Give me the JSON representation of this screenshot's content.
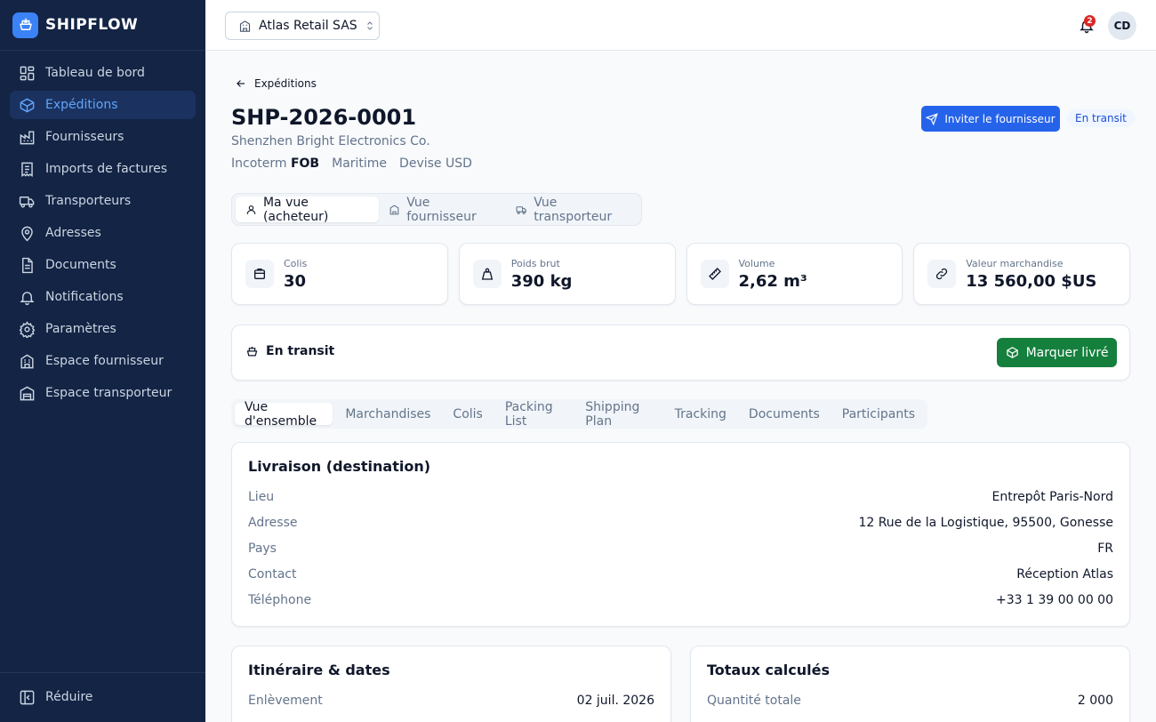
{
  "brand": {
    "name": "SHIPFLOW"
  },
  "sidebar": {
    "items": [
      {
        "label": "Tableau de bord",
        "icon": "dashboard-icon"
      },
      {
        "label": "Expéditions",
        "icon": "package-icon",
        "active": true
      },
      {
        "label": "Fournisseurs",
        "icon": "factory-icon"
      },
      {
        "label": "Imports de factures",
        "icon": "receipt-icon"
      },
      {
        "label": "Transporteurs",
        "icon": "truck-icon"
      },
      {
        "label": "Adresses",
        "icon": "map-pin-icon"
      },
      {
        "label": "Documents",
        "icon": "document-icon"
      },
      {
        "label": "Notifications",
        "icon": "bell-icon"
      },
      {
        "label": "Paramètres",
        "icon": "gear-icon"
      },
      {
        "label": "Espace fournisseur",
        "icon": "building-icon"
      },
      {
        "label": "Espace transporteur",
        "icon": "warehouse-icon"
      }
    ],
    "collapse_label": "Réduire"
  },
  "topbar": {
    "org_name": "Atlas Retail SAS",
    "notification_count": "2",
    "avatar_initials": "CD"
  },
  "shipment": {
    "back_label": "Expéditions",
    "reference": "SHP-2026-0001",
    "supplier": "Shenzhen Bright Electronics Co.",
    "incoterm_label": "Incoterm",
    "incoterm_value": "FOB",
    "mode": "Maritime",
    "currency": "Devise USD",
    "invite_label": "Inviter le fournisseur",
    "status_badge": "En transit"
  },
  "views": {
    "buyer": "Ma vue (acheteur)",
    "supplier": "Vue fournisseur",
    "carrier": "Vue transporteur"
  },
  "kpis": [
    {
      "label": "Colis",
      "value": "30",
      "icon": "package-icon"
    },
    {
      "label": "Poids brut",
      "value": "390 kg",
      "icon": "weight-icon"
    },
    {
      "label": "Volume",
      "value": "2,62 m³",
      "icon": "ruler-icon"
    },
    {
      "label": "Valeur marchandise",
      "value": "13 560,00 $US",
      "icon": "link-icon"
    }
  ],
  "status_card": {
    "label": "En transit",
    "action_label": "Marquer livré"
  },
  "tabs": [
    "Vue d'ensemble",
    "Marchandises",
    "Colis",
    "Packing List",
    "Shipping Plan",
    "Tracking",
    "Documents",
    "Participants"
  ],
  "delivery": {
    "title": "Livraison (destination)",
    "rows": [
      {
        "key": "Lieu",
        "value": "Entrepôt Paris-Nord"
      },
      {
        "key": "Adresse",
        "value": "12 Rue de la Logistique, 95500, Gonesse"
      },
      {
        "key": "Pays",
        "value": "FR"
      },
      {
        "key": "Contact",
        "value": "Réception Atlas"
      },
      {
        "key": "Téléphone",
        "value": "+33 1 39 00 00 00"
      }
    ]
  },
  "itinerary": {
    "title": "Itinéraire & dates",
    "rows": [
      {
        "key": "Enlèvement",
        "value": "02 juil. 2026"
      }
    ]
  },
  "totals": {
    "title": "Totaux calculés",
    "rows": [
      {
        "key": "Quantité totale",
        "value": "2 000"
      }
    ]
  },
  "colors": {
    "sidebar_bg": "#132445",
    "accent": "#2563eb",
    "success": "#15803d",
    "danger": "#dc2626"
  }
}
